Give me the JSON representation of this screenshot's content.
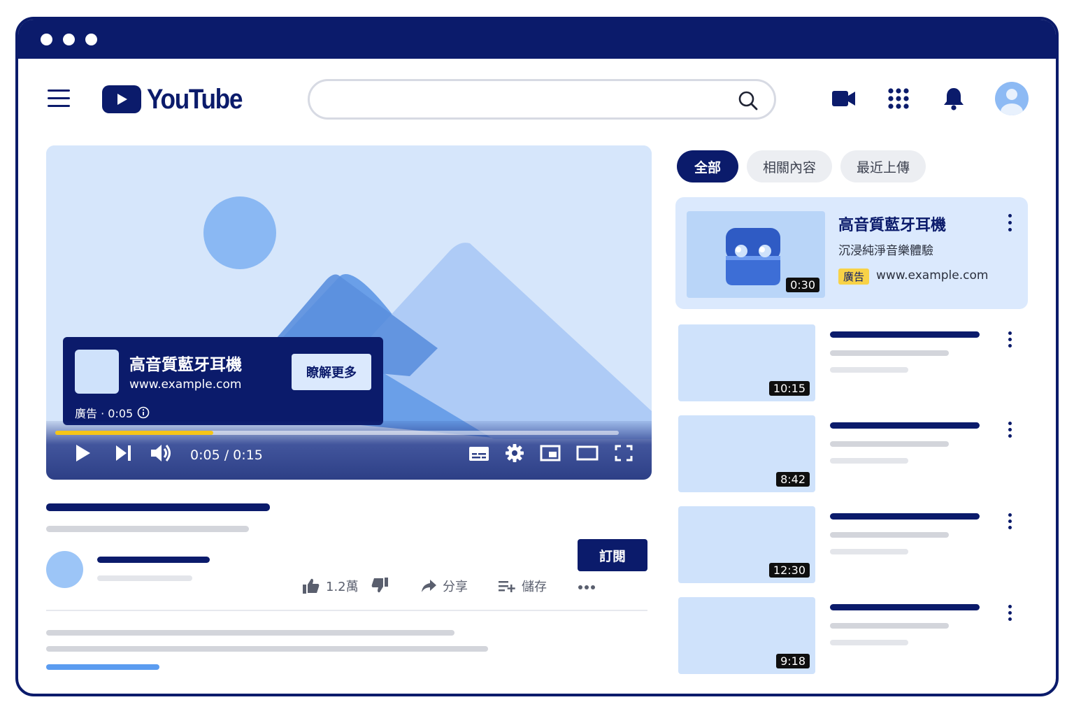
{
  "window": {
    "controls": [
      "close",
      "minimize",
      "maximize"
    ]
  },
  "header": {
    "logo_text": "YouTube",
    "search": {
      "value": "",
      "placeholder": ""
    },
    "icons": [
      "menu-icon",
      "search-icon",
      "video-camera-icon",
      "apps-grid-icon",
      "bell-icon",
      "account-avatar-icon"
    ]
  },
  "player": {
    "time": "0:05 / 0:15",
    "progress_fraction": 0.28,
    "ad_overlay": {
      "title": "高音質藍牙耳機",
      "url": "www.example.com",
      "cta": "瞭解更多",
      "meta": "廣告 · 0:05"
    }
  },
  "video_info": {
    "subscribe_label": "訂閱",
    "like_count": "1.2萬",
    "share_label": "分享",
    "save_label": "儲存"
  },
  "sidebar": {
    "chips": [
      {
        "label": "全部",
        "active": true
      },
      {
        "label": "相關內容",
        "active": false
      },
      {
        "label": "最近上傳",
        "active": false
      }
    ],
    "ad_card": {
      "title": "高音質藍牙耳機",
      "subtitle": "沉浸純淨音樂體驗",
      "badge": "廣告",
      "url": "www.example.com",
      "duration": "0:30"
    },
    "recommendations": [
      {
        "duration": "10:15"
      },
      {
        "duration": "8:42"
      },
      {
        "duration": "12:30"
      },
      {
        "duration": "9:18"
      }
    ]
  },
  "colors": {
    "navy": "#0b1b6b",
    "light_blue": "#dbe9fd",
    "progress": "#f5c518",
    "ad_badge": "#f8d247",
    "placeholder_gray": "#d3d5db"
  }
}
